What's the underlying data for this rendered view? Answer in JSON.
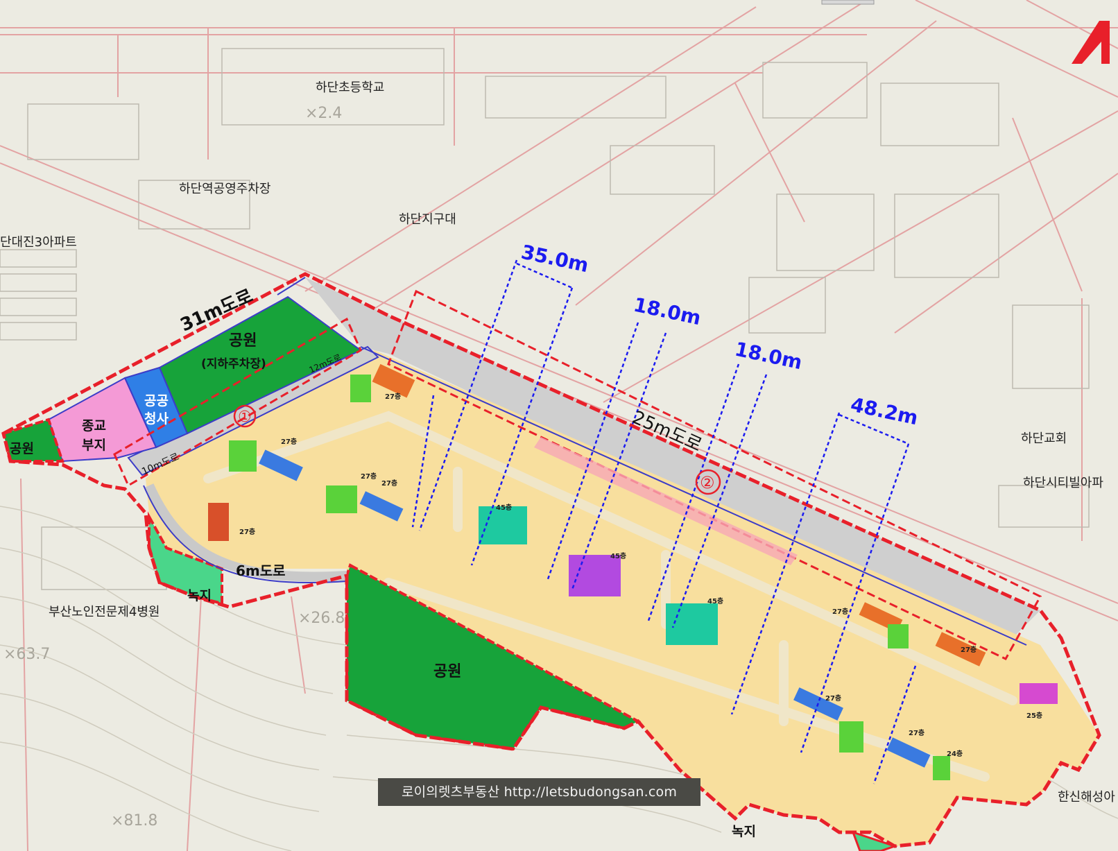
{
  "map": {
    "labels": {
      "school": "하단초등학교",
      "station_parking": "하단역공영주차장",
      "police": "하단지구대",
      "apartment_daejin": "단대진3아파트",
      "church": "하단교회",
      "city_building": "하단시티빌아파",
      "hospital": "부산노인전문제4병원",
      "hanshin": "한신해성아"
    },
    "zones": {
      "park_main": "공원",
      "park_main_sub": "(지하주차장)",
      "public_office_1": "공공",
      "public_office_2": "청사",
      "religious_1": "종교",
      "religious_2": "부지",
      "park_small": "공원",
      "park_south": "공원",
      "green_1": "녹지",
      "green_2": "녹지"
    },
    "roads": {
      "r31": "31m도로",
      "r25": "25m도로",
      "r12": "12m도로",
      "r10": "10m도로",
      "r6": "6m도로"
    },
    "dimensions": {
      "d1": "35.0m",
      "d2": "18.0m",
      "d3": "18.0m",
      "d4": "48.2m"
    },
    "markers": {
      "m1": "①",
      "m2": "②"
    },
    "spot_heights": {
      "h1": "×2.4",
      "h2": "×26.8",
      "h3": "×63.7",
      "h4": "×81.8"
    },
    "building_floors": [
      "27층",
      "27층",
      "27층",
      "27층",
      "27층",
      "45층",
      "45층",
      "45층",
      "27층",
      "27층",
      "27층",
      "27층",
      "25층",
      "24층"
    ],
    "logo_text": "A",
    "colors": {
      "background": "#ecebe2",
      "site_fill": "#f8df9e",
      "boundary_red": "#e8202a",
      "park_green": "#17a33a",
      "religious_pink": "#f49ad6",
      "public_blue": "#2f7fe6",
      "road_gray": "#cfcfcf",
      "dimension_blue": "#1b1bf0"
    }
  },
  "watermark": "로이의렛츠부동산 http://letsbudongsan.com"
}
